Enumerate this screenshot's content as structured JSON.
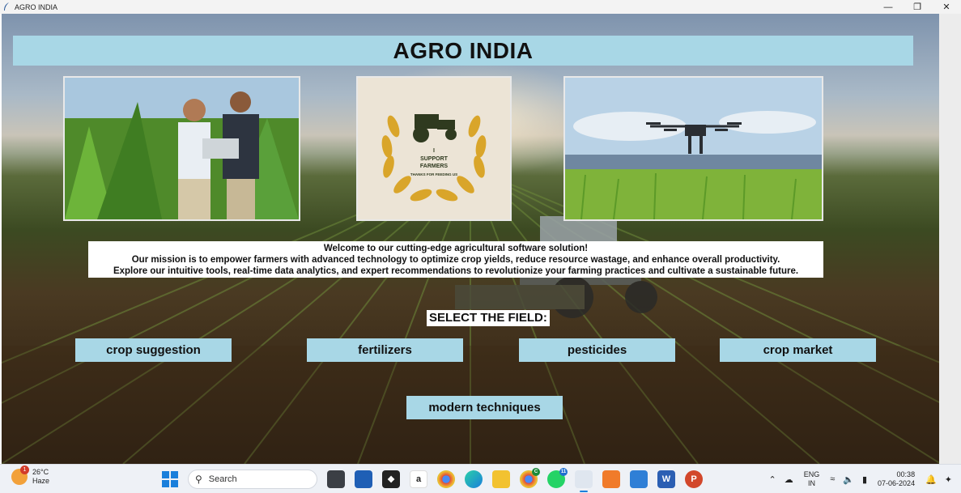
{
  "window": {
    "title": "AGRO INDIA",
    "minimize": "—",
    "restore": "❐",
    "close": "✕"
  },
  "header": {
    "title": "AGRO INDIA"
  },
  "logo_text": {
    "line1": "I",
    "line2": "SUPPORT",
    "line3": "FARMERS",
    "line4": "THANKS FOR FEEDING US"
  },
  "mission": {
    "line1": "Welcome to our cutting-edge agricultural software solution!",
    "line2": "Our mission is to empower farmers with advanced technology to optimize crop yields, reduce resource wastage, and enhance overall productivity.",
    "line3": "Explore our intuitive tools, real-time data analytics, and expert recommendations to revolutionize your farming practices and cultivate a sustainable future."
  },
  "select_label": "SELECT THE FIELD:",
  "buttons": {
    "crop_suggestion": "crop suggestion",
    "fertilizers": "fertilizers",
    "pesticides": "pesticides",
    "crop_market": "crop market",
    "modern_techniques": "modern techniques"
  },
  "taskbar": {
    "weather_badge": "1",
    "temperature": "26°C",
    "condition": "Haze",
    "search_placeholder": "Search",
    "language_1": "ENG",
    "language_2": "IN",
    "time": "00:38",
    "date": "07-06-2024",
    "icons": [
      "windows-start-icon",
      "search-icon",
      "task-view-icon",
      "store-icon",
      "dropbox-icon",
      "amazon-icon",
      "chrome-icon",
      "edge-icon",
      "file-explorer-icon",
      "chrome-profile-icon",
      "whatsapp-icon",
      "python-app-icon",
      "xampp-icon",
      "photos-icon",
      "word-icon",
      "powerpoint-icon"
    ],
    "chrome_badge": "C",
    "whatsapp_badge": "11"
  },
  "colors": {
    "banner": "#a8d7e6",
    "button": "#a8d7e6",
    "accent": "#1a7fdb"
  }
}
